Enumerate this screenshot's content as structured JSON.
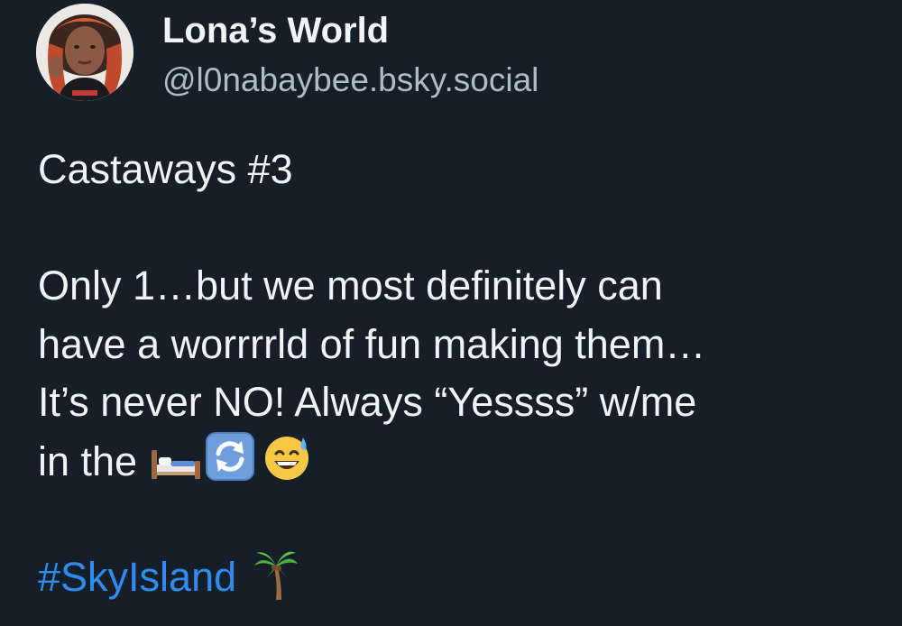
{
  "author": {
    "display_name": "Lona’s World",
    "handle": "@l0nabaybee.bsky.social"
  },
  "post": {
    "title_line": "Castaways #3",
    "body_lines": [
      "Only 1…but we most definitely can",
      "have a worrrrld of fun making them…",
      "It’s never NO! Always “Yessss” w/me",
      "in the"
    ],
    "hashtag": "#SkyIsland",
    "emojis": [
      "bed-icon",
      "repeat-arrows-icon",
      "grinning-sweat-face-icon",
      "palm-tree-icon"
    ]
  },
  "colors": {
    "background": "#161e27",
    "text": "#f1f3f5",
    "handle": "#aebbc9",
    "link": "#2e8cf1"
  }
}
